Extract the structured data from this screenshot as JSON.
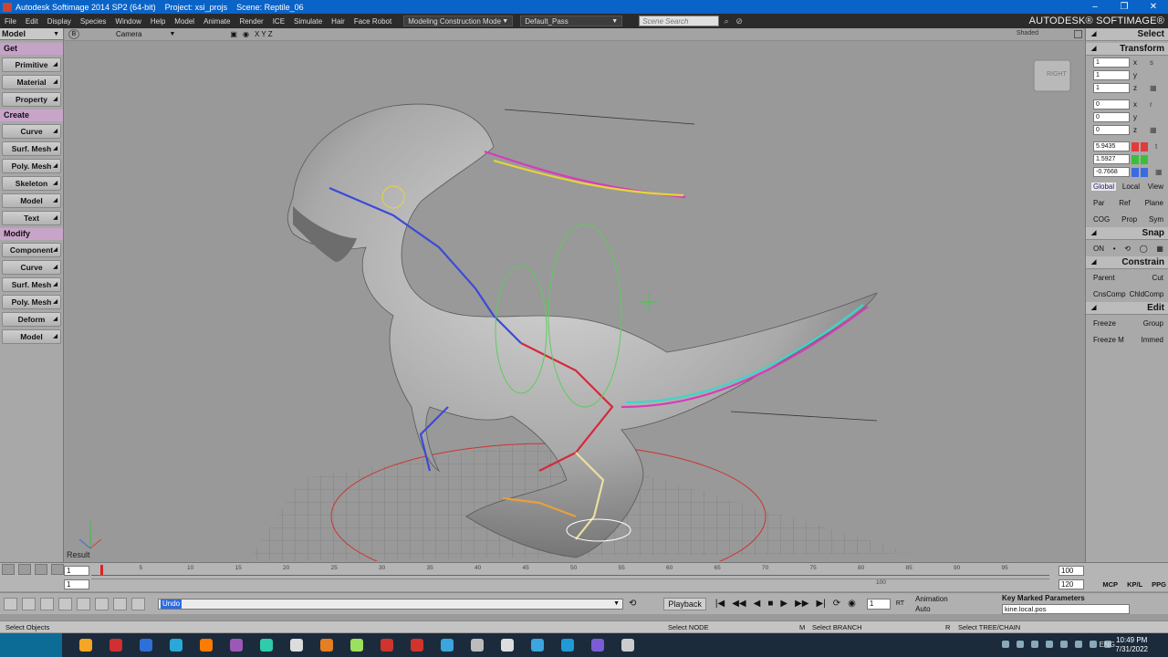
{
  "titlebar": {
    "app": "Autodesk Softimage 2014 SP2 (64-bit)",
    "project": "Project: xsi_projs",
    "scene": "Scene: Reptile_06",
    "buttons": [
      "–",
      "❐",
      "✕"
    ]
  },
  "menubar": {
    "items": [
      "File",
      "Edit",
      "Display",
      "Species",
      "Window",
      "Help",
      "Model",
      "Animate",
      "Render",
      "ICE",
      "Simulate",
      "Hair",
      "Face Robot"
    ],
    "construction_mode": "Modeling Construction Mode",
    "pass": "Default_Pass",
    "search_placeholder": "Scene Search",
    "brand": "AUTODESK® SOFTIMAGE®"
  },
  "lefttoolbar": {
    "mode": "Model",
    "sections": [
      {
        "title": "Get",
        "buttons": [
          "Primitive",
          "Material",
          "Property"
        ]
      },
      {
        "title": "Create",
        "buttons": [
          "Curve",
          "Surf. Mesh",
          "Poly. Mesh",
          "Skeleton",
          "Model",
          "Text"
        ]
      },
      {
        "title": "Modify",
        "buttons": [
          "Component",
          "Curve",
          "Surf. Mesh",
          "Poly. Mesh",
          "Deform",
          "Model"
        ]
      }
    ]
  },
  "viewport": {
    "letter": "B",
    "camera": "Camera",
    "axes_label": "X Y Z",
    "shading": "Shaded",
    "result": "Result",
    "view_cube": "RIGHT"
  },
  "rightpanel": {
    "select_title": "Select",
    "transform_title": "Transform",
    "scale": [
      {
        "value": "1",
        "axis": "x",
        "sfx": "s"
      },
      {
        "value": "1",
        "axis": "y",
        "sfx": ""
      },
      {
        "value": "1",
        "axis": "z",
        "sfx": "▦"
      }
    ],
    "rotate": [
      {
        "value": "0",
        "axis": "x",
        "sfx": "r"
      },
      {
        "value": "0",
        "axis": "y",
        "sfx": ""
      },
      {
        "value": "0",
        "axis": "z",
        "sfx": "▦"
      }
    ],
    "translate": [
      {
        "value": "5.9435",
        "axis": "x",
        "sfx": "t"
      },
      {
        "value": "1.5927",
        "axis": "y",
        "sfx": ""
      },
      {
        "value": "-0.7668",
        "axis": "z",
        "sfx": "▦"
      }
    ],
    "coord_buttons": [
      "Global",
      "Local",
      "View"
    ],
    "ref_buttons": [
      "Par",
      "Ref",
      "Plane"
    ],
    "cog_buttons": [
      "COG",
      "Prop",
      "Sym"
    ],
    "snap_title": "Snap",
    "snap_buttons": [
      "ON",
      "•",
      "⟲",
      "◯",
      "▦"
    ],
    "constrain_title": "Constrain",
    "constrain_row1": [
      "Parent",
      "Cut"
    ],
    "constrain_row2": [
      "CnsComp",
      "ChldComp"
    ],
    "edit_title": "Edit",
    "edit_row1": [
      "Freeze",
      "Group"
    ],
    "edit_row2": [
      "Freeze M",
      "Immed"
    ],
    "axis_colors": {
      "x": "#e23b3b",
      "y": "#3bbf3b",
      "z": "#3b6be2"
    }
  },
  "timeline": {
    "start_frame": "1",
    "start_frame2": "1",
    "end_frame": "100",
    "end_frame2": "120",
    "ticks": [
      "5",
      "10",
      "15",
      "20",
      "25",
      "30",
      "35",
      "40",
      "45",
      "50",
      "55",
      "60",
      "65",
      "70",
      "75",
      "80",
      "85",
      "90",
      "95"
    ],
    "ruler_end": "100",
    "tabs": [
      "MCP",
      "KP/L",
      "PPG"
    ]
  },
  "playbar": {
    "command": "Undo",
    "playback": "Playback",
    "transport": [
      "|◀",
      "◀◀",
      "◀",
      "■",
      "▶",
      "▶▶",
      "▶|",
      "⟳",
      "◉"
    ],
    "frame": "1",
    "rt": "RT",
    "animation": "Animation",
    "auto": "Auto",
    "key_title": "Key Marked Parameters",
    "key_value": "kine.local.pos"
  },
  "statusbar": {
    "left": "Select Objects",
    "node": "Select NODE",
    "branch": "Select BRANCH",
    "tree": "Select TREE/CHAIN",
    "m_label": "M",
    "r_label": "R"
  },
  "taskbar": {
    "time": "10:49 PM",
    "date": "7/31/2022",
    "lang": "ENG",
    "icon_colors": [
      "#f5a623",
      "#d03030",
      "#2f6fd8",
      "#2aa8d8",
      "#ff7b00",
      "#9b59b6",
      "#2eccaa",
      "#dddddd",
      "#e67e22",
      "#9be15d",
      "#d0342c",
      "#d0342c",
      "#3aa6dd",
      "#bbbbbb",
      "#dddddd",
      "#3aa6dd",
      "#1f9ad6",
      "#7b5cd6",
      "#cccccc"
    ]
  }
}
